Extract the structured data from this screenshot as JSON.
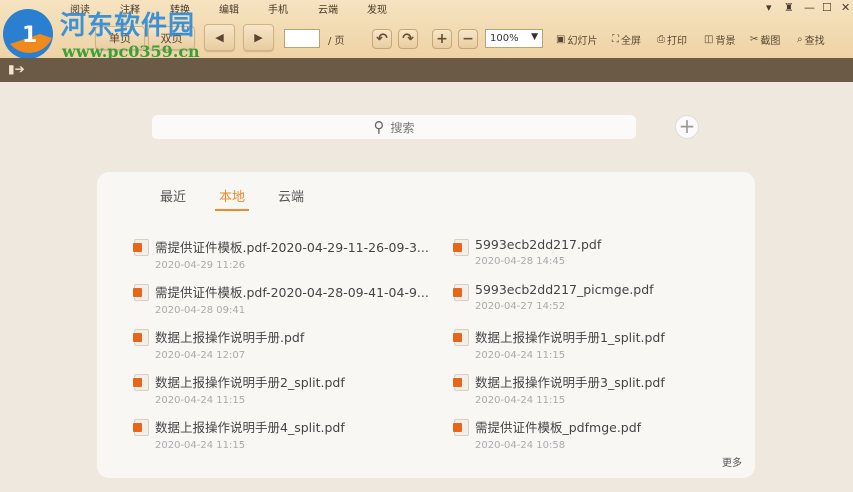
{
  "watermark": {
    "title": "河东软件园",
    "url": "www.pc0359.cn"
  },
  "menu": [
    "阅读",
    "注释",
    "转换",
    "编辑",
    "手机",
    "云端",
    "发现"
  ],
  "window_controls": [
    "skin",
    "shirt",
    "minimize",
    "maximize",
    "close"
  ],
  "toolbar": {
    "single_page": "单页",
    "double_page": "双页",
    "page_value": "",
    "page_suffix": "/ 页",
    "zoom": "100%",
    "slideshow": "幻灯片",
    "fullscreen": "全屏",
    "print": "打印",
    "background": "背景",
    "screenshot": "截图",
    "find": "查找"
  },
  "search": {
    "placeholder": "搜索"
  },
  "tabs": [
    "最近",
    "本地",
    "云端"
  ],
  "active_tab": "本地",
  "files": [
    {
      "name": "需提供证件模板.pdf-2020-04-29-11-26-09-3...",
      "date": "2020-04-29 11:26"
    },
    {
      "name": "5993ecb2dd217.pdf",
      "date": "2020-04-28 14:45"
    },
    {
      "name": "需提供证件模板.pdf-2020-04-28-09-41-04-9...",
      "date": "2020-04-28 09:41"
    },
    {
      "name": "5993ecb2dd217_picmge.pdf",
      "date": "2020-04-27 14:52"
    },
    {
      "name": "数据上报操作说明手册.pdf",
      "date": "2020-04-24 12:07"
    },
    {
      "name": "数据上报操作说明手册1_split.pdf",
      "date": "2020-04-24 11:15"
    },
    {
      "name": "数据上报操作说明手册2_split.pdf",
      "date": "2020-04-24 11:15"
    },
    {
      "name": "数据上报操作说明手册3_split.pdf",
      "date": "2020-04-24 11:15"
    },
    {
      "name": "数据上报操作说明手册4_split.pdf",
      "date": "2020-04-24 11:15"
    },
    {
      "name": "需提供证件模板_pdfmge.pdf",
      "date": "2020-04-24 10:58"
    }
  ],
  "more": "更多"
}
